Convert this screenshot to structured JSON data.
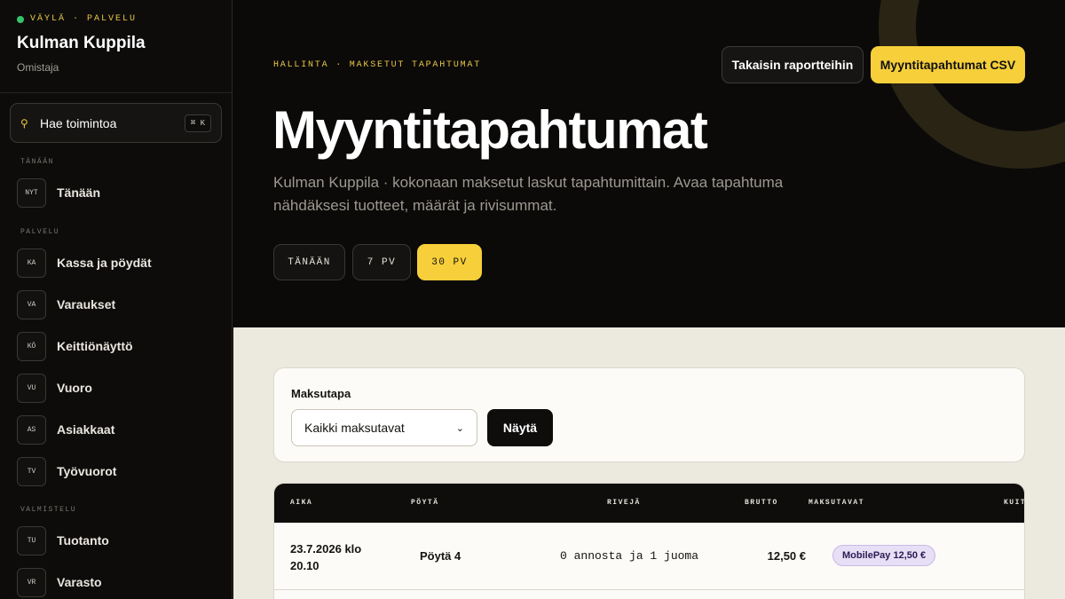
{
  "sidebar": {
    "brand_tag": "VÄYLÄ · PALVELU",
    "venue": "Kulman Kuppila",
    "role": "Omistaja",
    "search_label": "Hae toimintoa",
    "search_shortcut": "⌘ K",
    "sections": {
      "today": "TÄNÄÄN",
      "service": "PALVELU",
      "prep": "VALMISTELU"
    },
    "items": [
      {
        "badge": "NYT",
        "label": "Tänään"
      },
      {
        "badge": "KA",
        "label": "Kassa ja pöydät"
      },
      {
        "badge": "VA",
        "label": "Varaukset"
      },
      {
        "badge": "KÖ",
        "label": "Keittiönäyttö"
      },
      {
        "badge": "VU",
        "label": "Vuoro"
      },
      {
        "badge": "AS",
        "label": "Asiakkaat"
      },
      {
        "badge": "TV",
        "label": "Työvuorot"
      },
      {
        "badge": "TU",
        "label": "Tuotanto"
      },
      {
        "badge": "VR",
        "label": "Varasto"
      }
    ]
  },
  "hero": {
    "breadcrumb": "HALLINTA · MAKSETUT TAPAHTUMAT",
    "back_button": "Takaisin raportteihin",
    "csv_button": "Myyntitapahtumat CSV",
    "title": "Myyntitapahtumat",
    "subtitle": "Kulman Kuppila · kokonaan maksetut laskut tapahtumittain. Avaa tapahtuma nähdäksesi tuotteet, määrät ja rivisummat.",
    "ranges": [
      {
        "label": "TÄNÄÄN",
        "active": false
      },
      {
        "label": "7 PV",
        "active": false
      },
      {
        "label": "30 PV",
        "active": true
      }
    ]
  },
  "filter": {
    "label": "Maksutapa",
    "selected": "Kaikki maksutavat",
    "submit": "Näytä"
  },
  "table": {
    "columns": [
      "AIKA",
      "PÖYTÄ",
      "RIVEJÄ",
      "BRUTTO",
      "MAKSUTAVAT",
      "KUITTI"
    ],
    "rows": [
      {
        "time": "23.7.2026 klo 20.10",
        "table": "Pöytä 4",
        "lines": "0 annosta ja 1 juoma",
        "gross": "12,50 €",
        "payment": "MobilePay 12,50 €"
      }
    ]
  },
  "colors": {
    "accent": "#f6cf3a",
    "status_dot": "#36c46a",
    "payment_badge_bg": "#e7dff5"
  }
}
